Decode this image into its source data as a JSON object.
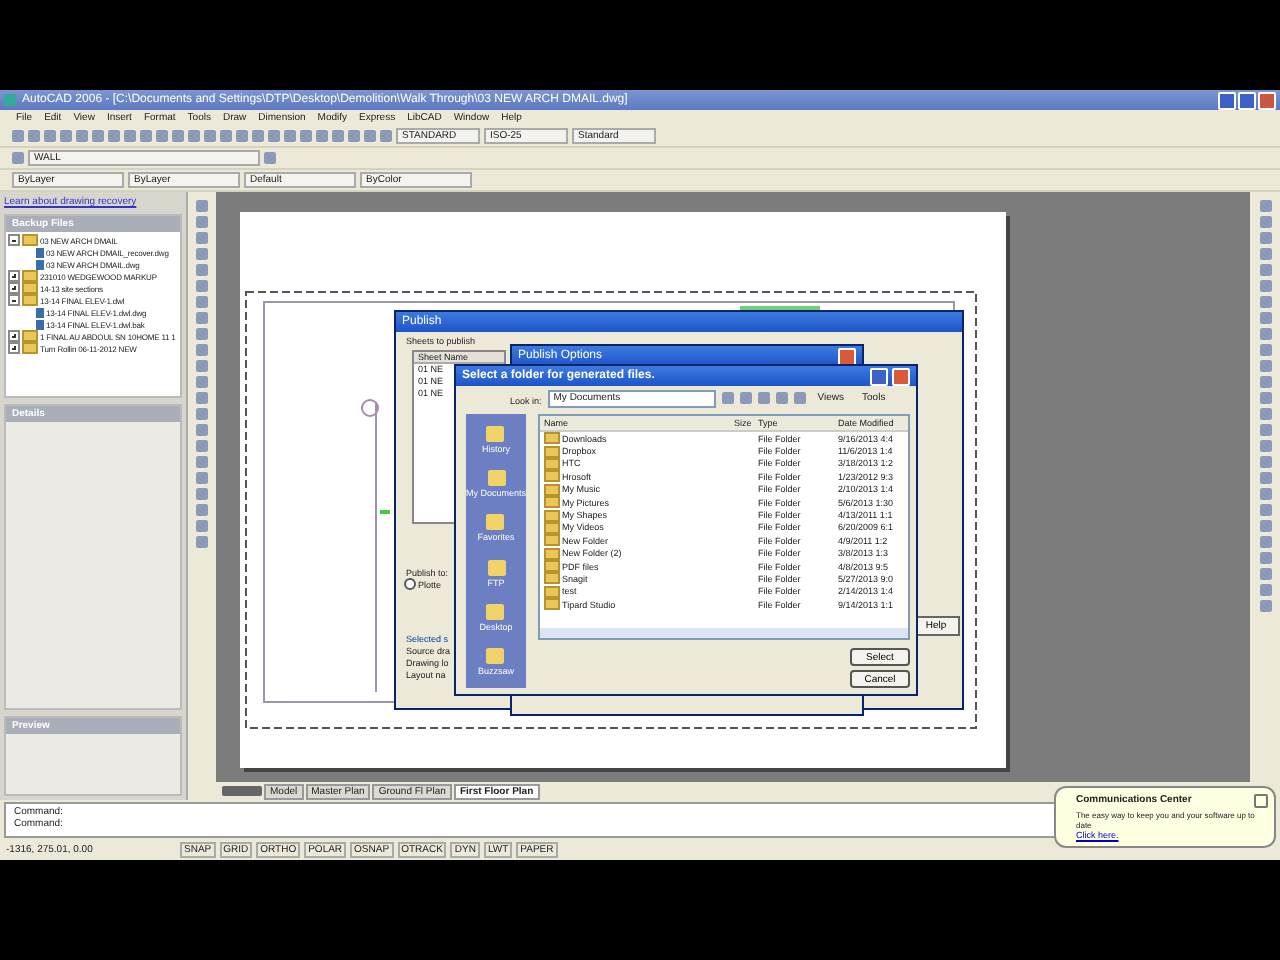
{
  "window": {
    "title": "AutoCAD 2006 - [C:\\Documents and Settings\\DTP\\Desktop\\Demolition\\Walk Through\\03 NEW ARCH DMAIL.dwg]"
  },
  "menu": [
    "File",
    "Edit",
    "View",
    "Insert",
    "Format",
    "Tools",
    "Draw",
    "Dimension",
    "Modify",
    "Express",
    "LibCAD",
    "Window",
    "Help"
  ],
  "toolbar": {
    "text_style": "STANDARD",
    "dim_style": "ISO-25",
    "table_style": "Standard",
    "layer": "WALL",
    "object_color": "ByLayer",
    "linetype": "ByLayer",
    "lineweight": "Default",
    "plot_style": "ByColor"
  },
  "recovery": {
    "link": "Learn about drawing recovery",
    "backup_title": "Backup Files",
    "details_title": "Details",
    "preview_title": "Preview",
    "tree": [
      {
        "label": "03 NEW ARCH DMAIL",
        "expanded": true,
        "children": [
          {
            "label": "03 NEW ARCH DMAIL_recover.dwg"
          },
          {
            "label": "03 NEW ARCH DMAIL.dwg"
          }
        ]
      },
      {
        "label": "231010 WEDGEWOOD MARKUP",
        "expanded": false
      },
      {
        "label": "14-13 site sections",
        "expanded": false
      },
      {
        "label": "13-14 FINAL ELEV-1.dwl",
        "expanded": true,
        "children": [
          {
            "label": "13-14 FINAL ELEV-1.dwl.dwg"
          },
          {
            "label": "13-14 FINAL ELEV-1.dwl.bak"
          }
        ]
      },
      {
        "label": "1 FINAL AU ABDOUL SN 10HOME 11 1",
        "expanded": false
      },
      {
        "label": "Turn Rollin 06-11-2012 NEW",
        "expanded": false
      }
    ]
  },
  "layout_tabs": [
    {
      "label": "Model",
      "selected": false
    },
    {
      "label": "Master Plan",
      "selected": false
    },
    {
      "label": "Ground Fl Plan",
      "selected": false
    },
    {
      "label": "First Floor Plan",
      "selected": true
    }
  ],
  "command_lines": [
    "Command:",
    "Command:"
  ],
  "status": {
    "coordinates": "-1316, 275.01, 0.00",
    "toggles": [
      {
        "label": "SNAP",
        "on": false
      },
      {
        "label": "GRID",
        "on": false
      },
      {
        "label": "ORTHO",
        "on": false
      },
      {
        "label": "POLAR",
        "on": false
      },
      {
        "label": "OSNAP",
        "on": false
      },
      {
        "label": "OTRACK",
        "on": false
      },
      {
        "label": "DYN",
        "on": false
      },
      {
        "label": "LWT",
        "on": false
      },
      {
        "label": "PAPER",
        "on": false
      }
    ]
  },
  "balloon": {
    "title": "Communications Center",
    "text": "The easy way to keep you and your software up to date",
    "link": "Click here."
  },
  "publish": {
    "title": "Publish",
    "sheets_label": "Sheets to publish",
    "column": "Sheet Name",
    "sheets": [
      "01 NE",
      "01 NE",
      "01 NE"
    ],
    "publish_to": "Publish to:",
    "plotter_option": {
      "label": "Plotte",
      "checked": false
    },
    "details_title": "Selected s",
    "details": [
      "Source dra",
      "Drawing lo",
      "Layout na"
    ],
    "help": "Help"
  },
  "options": {
    "title": "Publish Options"
  },
  "folder_dialog": {
    "title": "Select a folder for generated files.",
    "look_in": "Look in:",
    "location": "My Documents",
    "views": "Views",
    "tools": "Tools",
    "places": [
      "History",
      "My Documents",
      "Favorites",
      "FTP",
      "Desktop",
      "Buzzsaw"
    ],
    "columns": [
      "Name",
      "Size",
      "Type",
      "Date Modified"
    ],
    "rows": [
      {
        "name": "Downloads",
        "type": "File Folder",
        "date": "9/16/2013 4:4"
      },
      {
        "name": "Dropbox",
        "type": "File Folder",
        "date": "11/6/2013 1:4"
      },
      {
        "name": "HTC",
        "type": "File Folder",
        "date": "3/18/2013 1:2"
      },
      {
        "name": "Hrosoft",
        "type": "File Folder",
        "date": "1/23/2012 9:3"
      },
      {
        "name": "My Music",
        "type": "File Folder",
        "date": "2/10/2013 1:4"
      },
      {
        "name": "My Pictures",
        "type": "File Folder",
        "date": "5/6/2013 1:30"
      },
      {
        "name": "My Shapes",
        "type": "File Folder",
        "date": "4/13/2011 1:1"
      },
      {
        "name": "My Videos",
        "type": "File Folder",
        "date": "6/20/2009 6:1"
      },
      {
        "name": "New Folder",
        "type": "File Folder",
        "date": "4/9/2011 1:2"
      },
      {
        "name": "New Folder (2)",
        "type": "File Folder",
        "date": "3/8/2013 1:3"
      },
      {
        "name": "PDF files",
        "type": "File Folder",
        "date": "4/8/2013 9:5"
      },
      {
        "name": "Snagit",
        "type": "File Folder",
        "date": "5/27/2013 9:0"
      },
      {
        "name": "test",
        "type": "File Folder",
        "date": "2/14/2013 1:4"
      },
      {
        "name": "Tipard Studio",
        "type": "File Folder",
        "date": "9/14/2013 1:1"
      }
    ],
    "select": "Select",
    "cancel": "Cancel"
  }
}
